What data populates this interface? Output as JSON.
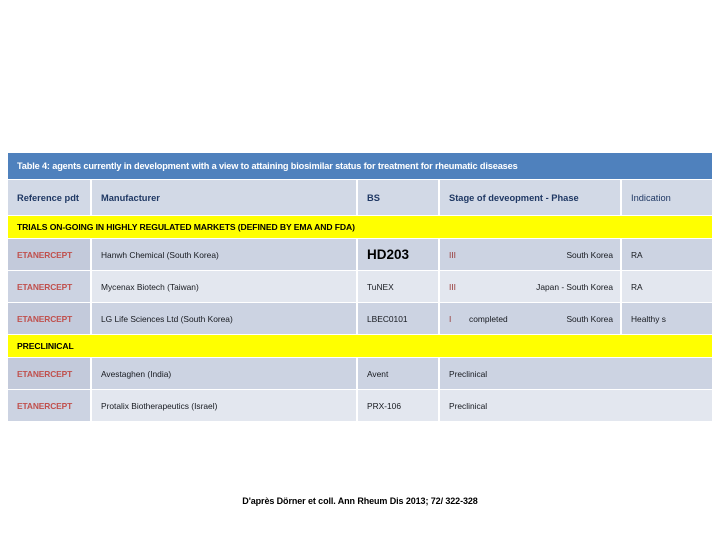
{
  "slide": {
    "table_title": "Table 4: agents currently in development with a view to attaining  biosimilar status for treatment for rheumatic diseases",
    "citation": "D'après Dörner et coll. Ann Rheum Dis 2013; 72/ 322-328"
  },
  "table": {
    "columns": [
      "Reference pdt",
      "Manufacturer",
      "BS",
      "Stage of deveopment  -  Phase",
      "Indication"
    ],
    "sections": [
      {
        "band": "TRIALS ON-GOING IN HIGHLY REGULATED MARKETS (DEFINED BY EMA AND FDA)",
        "rows": [
          {
            "reference": "ETANERCEPT",
            "manufacturer": "Hanwh Chemical (South Korea)",
            "bs": "HD203",
            "bs_emphasis": true,
            "phase": "III",
            "phase_note": "",
            "country": "South Korea",
            "indication": "RA"
          },
          {
            "reference": "ETANERCEPT",
            "manufacturer": "Mycenax Biotech (Taiwan)",
            "bs": "TuNEX",
            "bs_emphasis": false,
            "phase": "III",
            "phase_note": "",
            "country": "Japan -  South Korea",
            "indication": "RA"
          },
          {
            "reference": "ETANERCEPT",
            "manufacturer": "LG Life Sciences Ltd (South Korea)",
            "bs": "LBEC0101",
            "bs_emphasis": false,
            "phase": "I",
            "phase_note": "completed",
            "country": "South Korea",
            "indication": "Healthy s"
          }
        ]
      },
      {
        "band": "PRECLINICAL",
        "rows": [
          {
            "reference": "ETANERCEPT",
            "manufacturer": "Avestaghen (India)",
            "bs": "Avent",
            "bs_emphasis": false,
            "stage_plain": "Preclinical",
            "indication": ""
          },
          {
            "reference": "ETANERCEPT",
            "manufacturer": "Protalix Biotherapeutics (Israel)",
            "bs": "PRX-106",
            "bs_emphasis": false,
            "stage_plain": "Preclinical",
            "indication": ""
          }
        ]
      }
    ]
  },
  "colors": {
    "title_band": "#4f81bd",
    "section_band": "#ffff00",
    "header_text": "#1f3864",
    "reference_text": "#c0504d",
    "phase_text": "#963634",
    "row_shade_a": "#ccd3e2",
    "row_shade_b": "#e3e7ef"
  }
}
